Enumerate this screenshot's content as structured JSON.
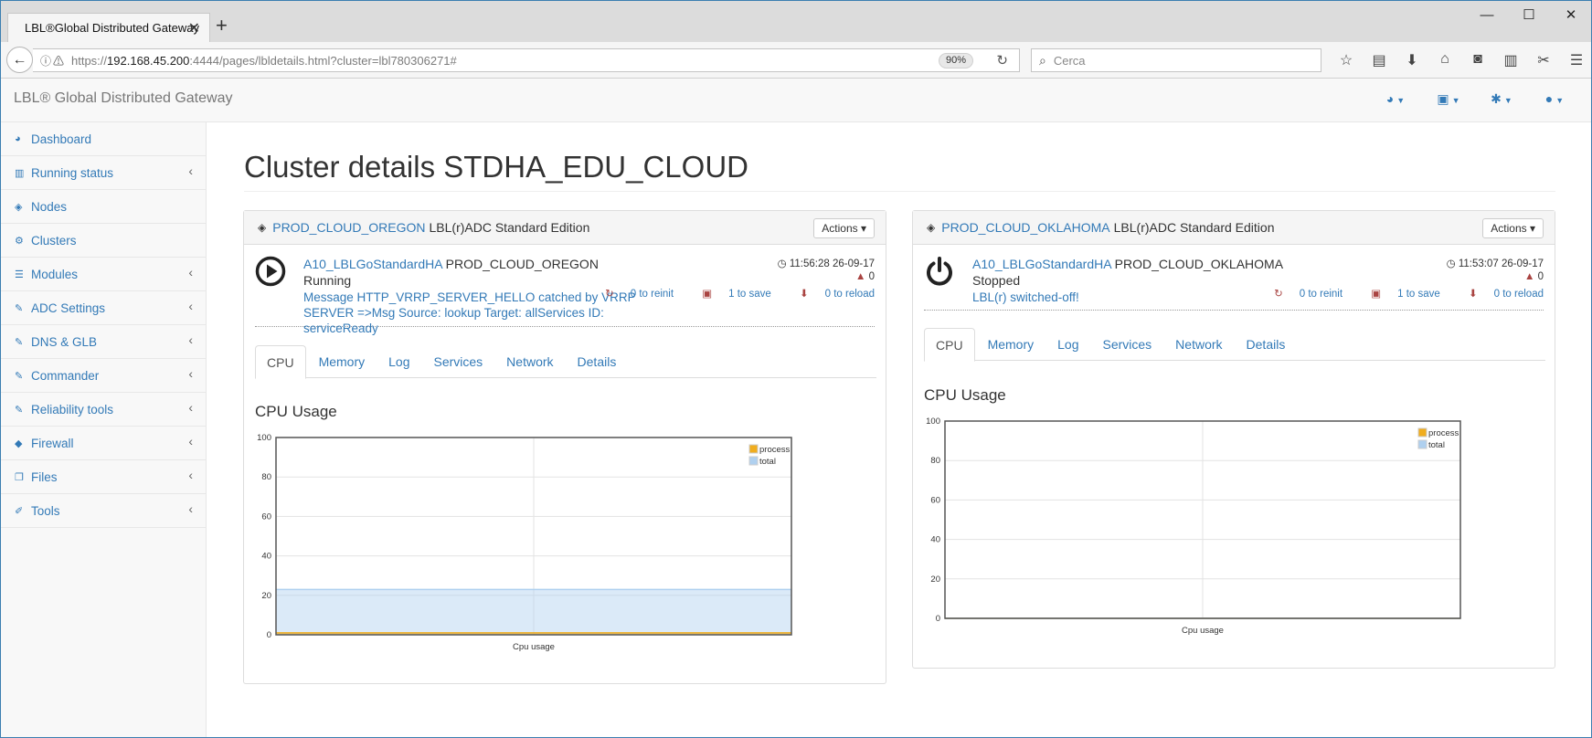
{
  "browser": {
    "tab_title": "LBL®Global Distributed Gateway",
    "url_prefix": "https://",
    "url_host": "192.168.45.200",
    "url_rest": ":4444/pages/lbldetails.html?cluster=lbl780306271#",
    "zoom": "90%",
    "search_placeholder": "Cerca"
  },
  "app": {
    "brand": "LBL® Global Distributed Gateway"
  },
  "sidebar": {
    "items": [
      {
        "label": "Dashboard",
        "icon": "dashboard-icon",
        "has_submenu": false
      },
      {
        "label": "Running status",
        "icon": "bar-chart-icon",
        "has_submenu": true
      },
      {
        "label": "Nodes",
        "icon": "cube-icon",
        "has_submenu": false
      },
      {
        "label": "Clusters",
        "icon": "cogs-icon",
        "has_submenu": false
      },
      {
        "label": "Modules",
        "icon": "list-icon",
        "has_submenu": true
      },
      {
        "label": "ADC Settings",
        "icon": "edit-icon",
        "has_submenu": true
      },
      {
        "label": "DNS & GLB",
        "icon": "edit-icon",
        "has_submenu": true
      },
      {
        "label": "Commander",
        "icon": "edit-icon",
        "has_submenu": true
      },
      {
        "label": "Reliability tools",
        "icon": "edit-icon",
        "has_submenu": true
      },
      {
        "label": "Firewall",
        "icon": "shield-icon",
        "has_submenu": true
      },
      {
        "label": "Files",
        "icon": "files-icon",
        "has_submenu": true
      },
      {
        "label": "Tools",
        "icon": "wrench-icon",
        "has_submenu": true
      }
    ]
  },
  "page": {
    "title": "Cluster details STDHA_EDU_CLOUD"
  },
  "panels": {
    "oregon": {
      "cluster_link": "PROD_CLOUD_OREGON",
      "edition": "LBL(r)ADC Standard Edition",
      "actions_label": "Actions",
      "node_link": "A10_LBLGoStandardHA",
      "node_name": "PROD_CLOUD_OREGON",
      "status": "Running",
      "message": "Message HTTP_VRRP_SERVER_HELLO catched by VRRP SERVER =>Msg Source: lookup Target: allServices ID: serviceReady",
      "time": "11:56:28 26-09-17",
      "warnings": "0",
      "reinit": "0 to reinit",
      "save": "1 to save",
      "reload": "0 to reload",
      "tabs": [
        "CPU",
        "Memory",
        "Log",
        "Services",
        "Network",
        "Details"
      ],
      "chart_title": "CPU Usage"
    },
    "oklahoma": {
      "cluster_link": "PROD_CLOUD_OKLAHOMA",
      "edition": "LBL(r)ADC Standard Edition",
      "actions_label": "Actions",
      "node_link": "A10_LBLGoStandardHA",
      "node_name": "PROD_CLOUD_OKLAHOMA",
      "status": "Stopped",
      "message": "LBL(r) switched-off!",
      "time": "11:53:07 26-09-17",
      "warnings": "0",
      "reinit": "0 to reinit",
      "save": "1 to save",
      "reload": "0 to reload",
      "tabs": [
        "CPU",
        "Memory",
        "Log",
        "Services",
        "Network",
        "Details"
      ],
      "chart_title": "CPU Usage"
    }
  },
  "chart_data": [
    {
      "type": "area",
      "xlabel": "Cpu usage",
      "ylim": [
        0,
        100
      ],
      "yticks": [
        0,
        20,
        40,
        60,
        80,
        100
      ],
      "grid": true,
      "legend_position": "top-right",
      "series": [
        {
          "name": "process",
          "values": [
            1,
            1
          ],
          "color": "#f0ad1e"
        },
        {
          "name": "total",
          "values": [
            23,
            23
          ],
          "color": "#afd0ef"
        }
      ]
    },
    {
      "type": "area",
      "xlabel": "Cpu usage",
      "ylim": [
        0,
        100
      ],
      "yticks": [
        0,
        20,
        40,
        60,
        80,
        100
      ],
      "grid": true,
      "legend_position": "top-right",
      "series": [
        {
          "name": "process",
          "values": [
            0,
            0
          ],
          "color": "#f0ad1e"
        },
        {
          "name": "total",
          "values": [
            0,
            0
          ],
          "color": "#afd0ef"
        }
      ]
    }
  ]
}
